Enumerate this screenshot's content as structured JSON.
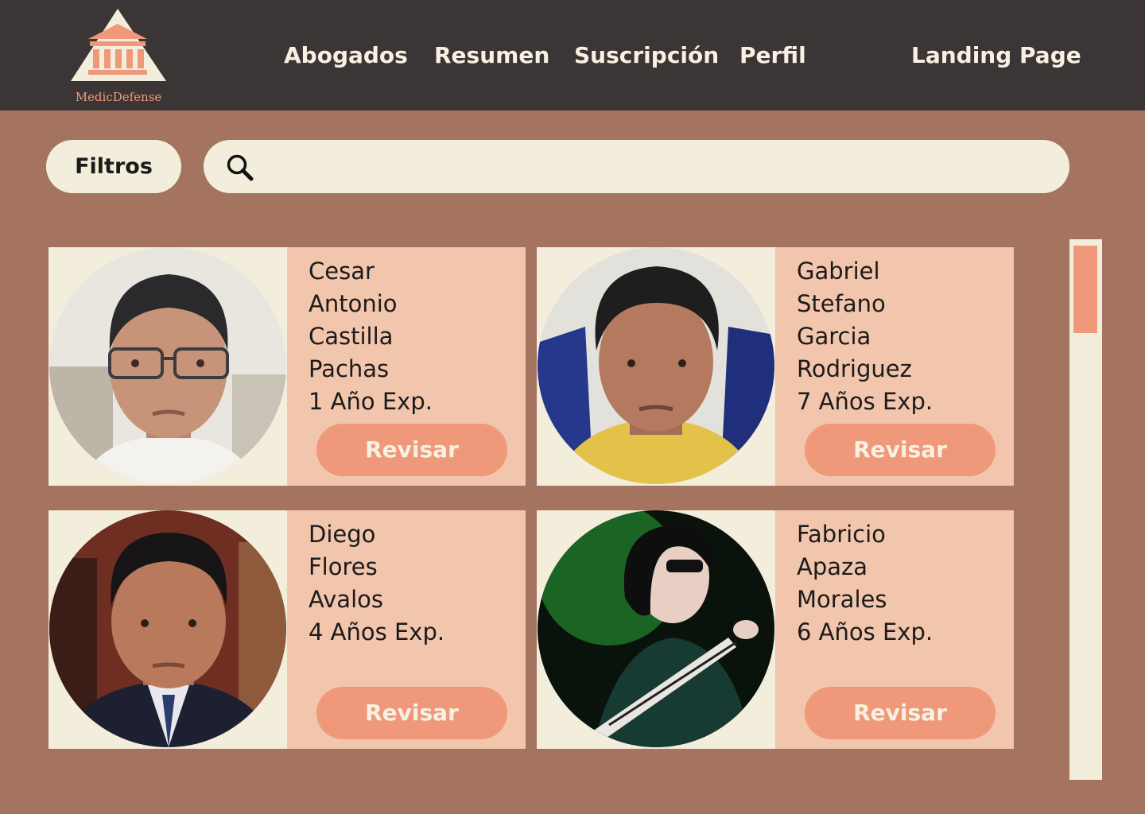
{
  "header": {
    "brand": "MedicDefense",
    "nav": {
      "lawyers": "Abogados",
      "summary": "Resumen",
      "subscription": "Suscripción",
      "profile": "Perfil",
      "landing": "Landing Page"
    }
  },
  "toolbar": {
    "filters_label": "Filtros",
    "search_placeholder": "",
    "search_value": ""
  },
  "lawyers": [
    {
      "name_lines": [
        "Cesar",
        "Antonio",
        "Castilla",
        "Pachas"
      ],
      "experience": "1 Año Exp.",
      "button": "Revisar"
    },
    {
      "name_lines": [
        "Gabriel",
        "Stefano",
        "Garcia",
        "Rodriguez"
      ],
      "experience": "7 Años Exp.",
      "button": "Revisar"
    },
    {
      "name_lines": [
        "Diego",
        "Flores",
        "Avalos"
      ],
      "experience": "4 Años Exp.",
      "button": "Revisar"
    },
    {
      "name_lines": [
        "Fabricio",
        "Apaza",
        "Morales"
      ],
      "experience": "6 Años Exp.",
      "button": "Revisar"
    }
  ],
  "colors": {
    "header_bg": "#3c3536",
    "page_bg": "#a57461",
    "card_bg": "#f2c5ad",
    "cream": "#f2eedb",
    "accent": "#f0987a"
  },
  "icons": {
    "logo": "courthouse-icon",
    "search": "search-icon"
  }
}
